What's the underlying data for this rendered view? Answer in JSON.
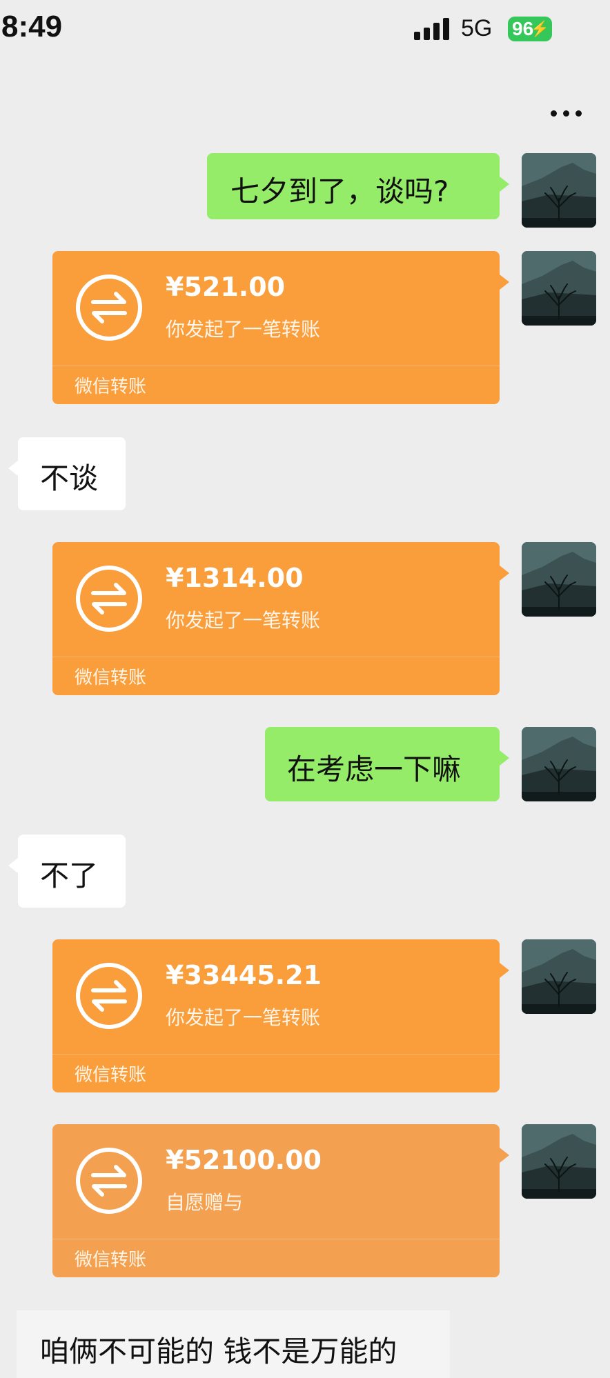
{
  "status_bar": {
    "time": "8:49",
    "network": "5G",
    "battery": "96"
  },
  "messages": [
    {
      "side": "right",
      "type": "text",
      "text": "七夕到了，谈吗?"
    },
    {
      "side": "right",
      "type": "transfer",
      "amount": "¥521.00",
      "desc": "你发起了一笔转账",
      "brand": "微信转账"
    },
    {
      "side": "left",
      "type": "text",
      "text": "不谈"
    },
    {
      "side": "right",
      "type": "transfer",
      "amount": "¥1314.00",
      "desc": "你发起了一笔转账",
      "brand": "微信转账"
    },
    {
      "side": "right",
      "type": "text",
      "text": "在考虑一下嘛"
    },
    {
      "side": "left",
      "type": "text",
      "text": "不了"
    },
    {
      "side": "right",
      "type": "transfer",
      "amount": "¥33445.21",
      "desc": "你发起了一笔转账",
      "brand": "微信转账"
    },
    {
      "side": "right",
      "type": "transfer",
      "amount": "¥52100.00",
      "desc": "自愿赠与",
      "brand": "微信转账"
    }
  ],
  "caption": "咱俩不可能的 钱不是万能的",
  "colors": {
    "background": "#ededed",
    "green_bubble": "#95ec69",
    "transfer_orange": "#fa9d3b"
  },
  "icons": [
    "more-icon",
    "transfer-arrows-icon",
    "avatar-mountain-tree"
  ]
}
